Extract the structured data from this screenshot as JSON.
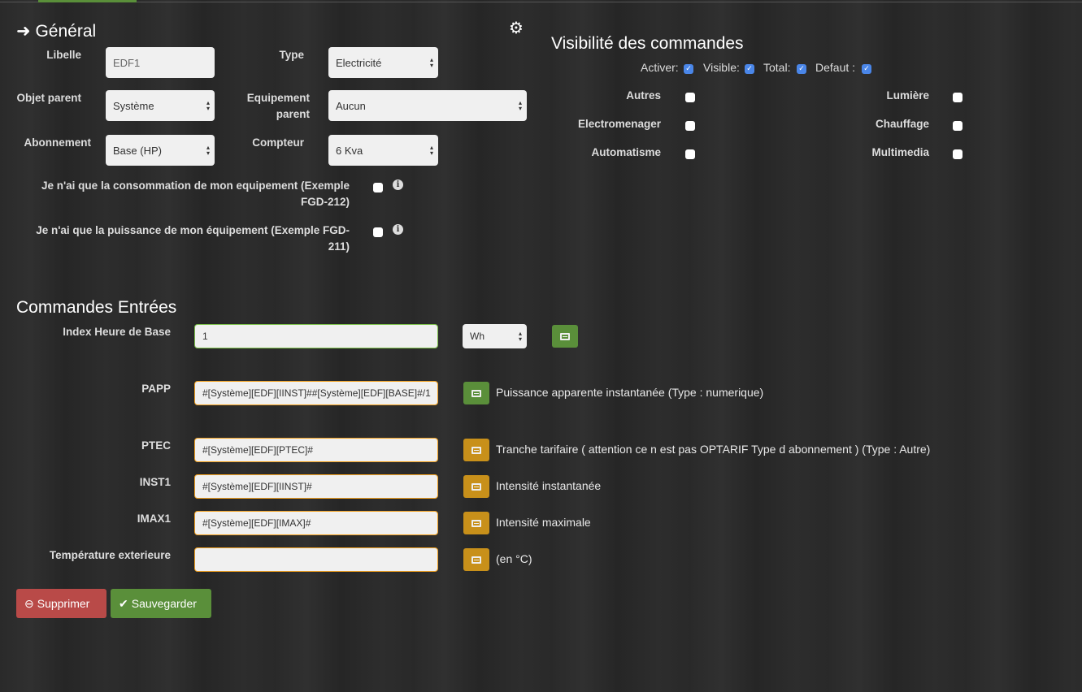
{
  "general": {
    "title": "Général",
    "libelle_label": "Libelle",
    "libelle_value": "EDF1",
    "type_label": "Type",
    "type_value": "Electricité",
    "objet_label": "Objet parent",
    "objet_value": "Système",
    "equip_label": "Equipement parent",
    "equip_value": "Aucun",
    "abonnement_label": "Abonnement",
    "abonnement_value": "Base (HP)",
    "compteur_label": "Compteur",
    "compteur_value": "6 Kva",
    "conso_label": "Je n'ai que la consommation de mon equipement (Exemple FGD-212)",
    "puissance_label": "Je n'ai que la puissance de mon équipement (Exemple FGD-211)"
  },
  "visibility": {
    "title": "Visibilité des commandes",
    "flags": [
      {
        "label": "Activer:",
        "checked": true
      },
      {
        "label": "Visible:",
        "checked": true
      },
      {
        "label": "Total:",
        "checked": true
      },
      {
        "label": "Defaut :",
        "checked": true
      }
    ],
    "categories": [
      "Autres",
      "Electromenager",
      "Automatisme",
      "Lumière",
      "Chauffage",
      "Multimedia"
    ]
  },
  "commands": {
    "title": "Commandes Entrées",
    "index_label": "Index Heure de Base",
    "index_value": "1",
    "index_unit": "Wh",
    "rows": [
      {
        "label": "PAPP",
        "value": "#[Système][EDF][IINST]##[Système][EDF][BASE]#/1",
        "desc": "Puissance apparente instantanée (Type : numerique)"
      },
      {
        "label": "PTEC",
        "value": "#[Système][EDF][PTEC]#",
        "desc": "Tranche tarifaire ( attention ce n est pas OPTARIF Type d abonnement ) (Type : Autre)"
      },
      {
        "label": "INST1",
        "value": "#[Système][EDF][IINST]#",
        "desc": "Intensité instantanée"
      },
      {
        "label": "IMAX1",
        "value": "#[Système][EDF][IMAX]#",
        "desc": "Intensité maximale"
      },
      {
        "label": "Température exterieure",
        "value": "",
        "desc": "(en °C)"
      }
    ]
  },
  "actions": {
    "delete": "Supprimer",
    "save": "Sauvegarder"
  },
  "colors": {
    "green": "#5a8f3a",
    "orange": "#c8901a",
    "red": "#b94a48"
  }
}
